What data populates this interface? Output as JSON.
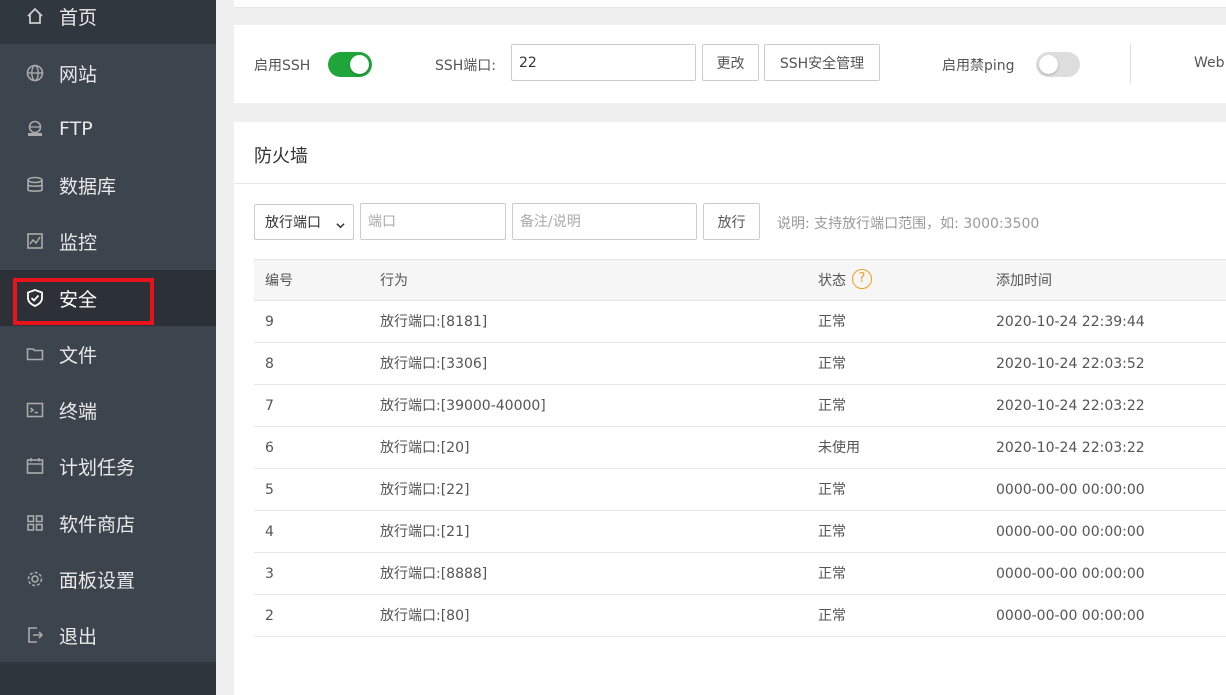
{
  "sidebar": {
    "items": [
      {
        "label": "首页",
        "icon": "home-icon"
      },
      {
        "label": "网站",
        "icon": "globe-icon"
      },
      {
        "label": "FTP",
        "icon": "ftp-icon"
      },
      {
        "label": "数据库",
        "icon": "database-icon"
      },
      {
        "label": "监控",
        "icon": "monitor-icon"
      },
      {
        "label": "安全",
        "icon": "shield-icon"
      },
      {
        "label": "文件",
        "icon": "folder-icon"
      },
      {
        "label": "终端",
        "icon": "terminal-icon"
      },
      {
        "label": "计划任务",
        "icon": "calendar-icon"
      },
      {
        "label": "软件商店",
        "icon": "grid-icon"
      },
      {
        "label": "面板设置",
        "icon": "gear-icon"
      },
      {
        "label": "退出",
        "icon": "logout-icon"
      }
    ],
    "active": "安全",
    "highlight_color": "#e8141d"
  },
  "ssh": {
    "enable_label": "启用SSH",
    "enable_on": true,
    "port_label": "SSH端口:",
    "port_value": "22",
    "change_button": "更改",
    "manage_button": "SSH安全管理",
    "ping_label": "启用禁ping",
    "ping_on": false,
    "web_label": "Web"
  },
  "firewall": {
    "title": "防火墙",
    "select_value": "放行端口",
    "port_placeholder": "端口",
    "note_placeholder": "备注/说明",
    "allow_button": "放行",
    "hint": "说明: 支持放行端口范围，如: 3000:3500",
    "columns": [
      "编号",
      "行为",
      "状态",
      "添加时间"
    ],
    "rows": [
      {
        "id": "9",
        "action": "放行端口:[8181]",
        "status": "正常",
        "time": "2020-10-24 22:39:44"
      },
      {
        "id": "8",
        "action": "放行端口:[3306]",
        "status": "正常",
        "time": "2020-10-24 22:03:52"
      },
      {
        "id": "7",
        "action": "放行端口:[39000-40000]",
        "status": "正常",
        "time": "2020-10-24 22:03:22"
      },
      {
        "id": "6",
        "action": "放行端口:[20]",
        "status": "未使用",
        "time": "2020-10-24 22:03:22"
      },
      {
        "id": "5",
        "action": "放行端口:[22]",
        "status": "正常",
        "time": "0000-00-00 00:00:00"
      },
      {
        "id": "4",
        "action": "放行端口:[21]",
        "status": "正常",
        "time": "0000-00-00 00:00:00"
      },
      {
        "id": "3",
        "action": "放行端口:[8888]",
        "status": "正常",
        "time": "0000-00-00 00:00:00"
      },
      {
        "id": "2",
        "action": "放行端口:[80]",
        "status": "正常",
        "time": "0000-00-00 00:00:00"
      }
    ]
  },
  "colors": {
    "sidebar_bg": "#3c444d",
    "toggle_on": "#20a53a",
    "help_icon": "#f0a020"
  }
}
